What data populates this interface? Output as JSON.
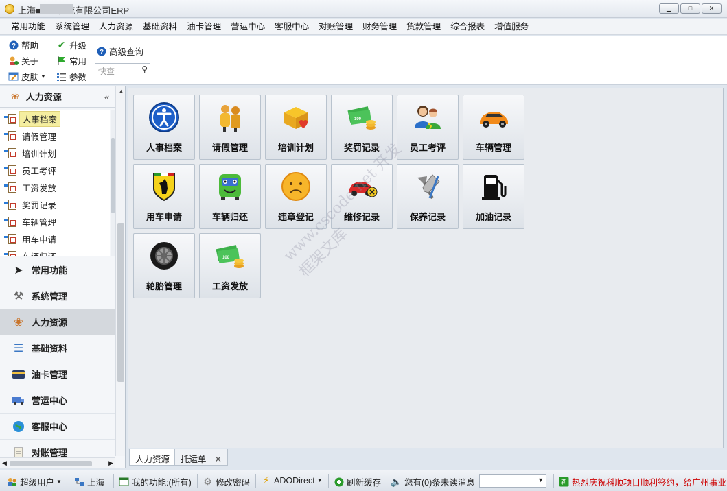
{
  "window": {
    "title": "上海■■■■物流有限公司ERP",
    "buttons": [
      "▁",
      "□",
      "✕"
    ]
  },
  "menu": [
    "常用功能",
    "系统管理",
    "人力资源",
    "基础资料",
    "油卡管理",
    "营运中心",
    "客服中心",
    "对账管理",
    "财务管理",
    "货款管理",
    "综合报表",
    "增值服务"
  ],
  "toolbar": {
    "help": "帮助",
    "about": "关于",
    "skin": "皮肤",
    "upgrade": "升级",
    "common": "常用",
    "params": "参数",
    "advanced_search": "高级查询",
    "quick_search_placeholder": "快查"
  },
  "left_panel": {
    "title": "人力资源",
    "tree": [
      "人事档案",
      "请假管理",
      "培训计划",
      "员工考评",
      "工资发放",
      "奖罚记录",
      "车辆管理",
      "用车申请",
      "车辆归还"
    ],
    "selected": "人事档案",
    "nav": [
      "常用功能",
      "系统管理",
      "人力资源",
      "基础资料",
      "油卡管理",
      "营运中心",
      "客服中心",
      "对账管理"
    ],
    "active_nav": "人力资源"
  },
  "tiles": [
    "人事档案",
    "请假管理",
    "培训计划",
    "奖罚记录",
    "员工考评",
    "车辆管理",
    "用车申请",
    "车辆归还",
    "违章登记",
    "维修记录",
    "保养记录",
    "加油记录",
    "轮胎管理",
    "工资发放"
  ],
  "doc_tabs": {
    "tab1": "人力资源",
    "tab2": "托运单"
  },
  "status": {
    "user": "超级用户",
    "city": "上海",
    "my_functions": "我的功能:(所有)",
    "change_password": "修改密码",
    "ado": "ADODirect",
    "refresh_cache": "刷新缓存",
    "messages": "您有(0)条未读消息",
    "news": "热烈庆祝科顺项目顺利签约，给广州事业"
  },
  "watermark": "www.cscode.net 开发框架文库"
}
